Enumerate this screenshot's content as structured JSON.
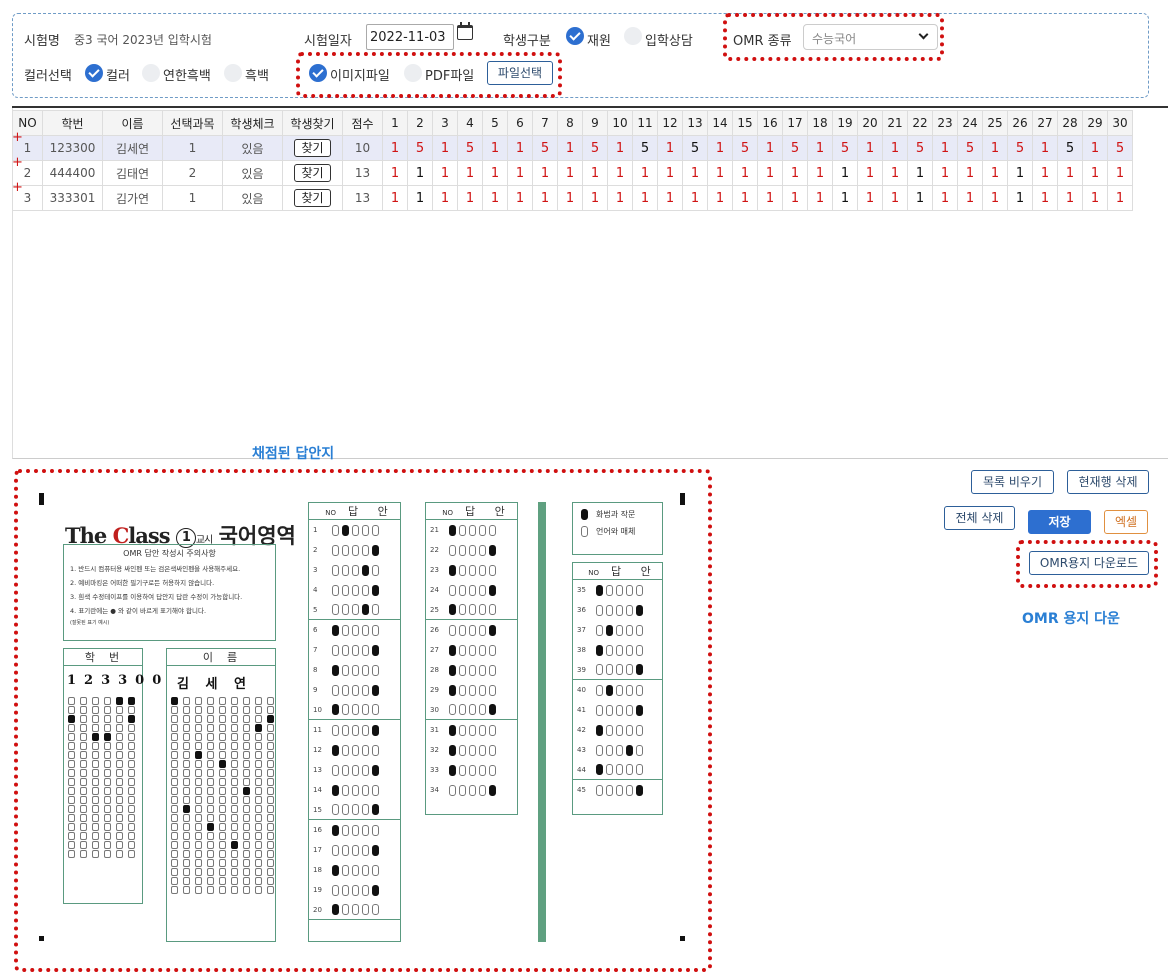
{
  "filters": {
    "exam_name_label": "시험명",
    "exam_name_value": "중3 국어 2023년 입학시험",
    "exam_date_label": "시험일자",
    "exam_date_value": "2022-11-03",
    "student_type_label": "학생구분",
    "student_type_options": [
      "재원",
      "입학상담"
    ],
    "omr_type_label": "OMR 종류",
    "omr_type_value": "수능국어",
    "color_label": "컬러선택",
    "color_options": [
      "컬러",
      "연한흑백",
      "흑백"
    ],
    "file_options": [
      "이미지파일",
      "PDF파일"
    ],
    "file_select_button": "파일선택"
  },
  "grid": {
    "headers": [
      "NO",
      "학번",
      "이름",
      "선택과목",
      "학생체크",
      "학생찾기",
      "점수"
    ],
    "question_numbers": [
      "1",
      "2",
      "3",
      "4",
      "5",
      "6",
      "7",
      "8",
      "9",
      "10",
      "11",
      "12",
      "13",
      "14",
      "15",
      "16",
      "17",
      "18",
      "19",
      "20",
      "21",
      "22",
      "23",
      "24",
      "25",
      "26",
      "27",
      "28",
      "29",
      "30"
    ],
    "find_label": "찾기",
    "rows": [
      {
        "no": "1",
        "id": "123300",
        "name": "김세연",
        "subject": "1",
        "check": "있음",
        "score": "10",
        "answers": [
          "1",
          "5",
          "1",
          "5",
          "1",
          "1",
          "5",
          "1",
          "5",
          "1",
          "5",
          "1",
          "5",
          "1",
          "5",
          "1",
          "5",
          "1",
          "5",
          "1",
          "1",
          "5",
          "1",
          "5",
          "1",
          "5",
          "1",
          "5",
          "1",
          "5"
        ],
        "correct": [
          11,
          13,
          28
        ]
      },
      {
        "no": "2",
        "id": "444400",
        "name": "김태연",
        "subject": "2",
        "check": "있음",
        "score": "13",
        "answers": [
          "1",
          "1",
          "1",
          "1",
          "1",
          "1",
          "1",
          "1",
          "1",
          "1",
          "1",
          "1",
          "1",
          "1",
          "1",
          "1",
          "1",
          "1",
          "1",
          "1",
          "1",
          "1",
          "1",
          "1",
          "1",
          "1",
          "1",
          "1",
          "1",
          "1"
        ],
        "correct": [
          2,
          19,
          22,
          26
        ]
      },
      {
        "no": "3",
        "id": "333301",
        "name": "김가연",
        "subject": "1",
        "check": "있음",
        "score": "13",
        "answers": [
          "1",
          "1",
          "1",
          "1",
          "1",
          "1",
          "1",
          "1",
          "1",
          "1",
          "1",
          "1",
          "1",
          "1",
          "1",
          "1",
          "1",
          "1",
          "1",
          "1",
          "1",
          "1",
          "1",
          "1",
          "1",
          "1",
          "1",
          "1",
          "1",
          "1"
        ],
        "correct": [
          2,
          19,
          22,
          26
        ]
      }
    ]
  },
  "section_title": "채점된 답안지",
  "actions": {
    "clear_list": "목록 비우기",
    "delete_current_row": "현재행 삭제",
    "delete_all": "전체 삭제",
    "save": "저장",
    "excel": "엑셀",
    "omr_download": "OMR용지 다운로드",
    "omr_download_caption": "OMR 용지 다운"
  },
  "omr_sheet": {
    "title_prefix": "The ",
    "title_c": "C",
    "title_rest": "lass ",
    "title_num": "1",
    "title_period": "교시",
    "title_subject": "국어영역",
    "notes_head": "OMR 답안 작성시 주의사항",
    "notes": [
      "1. 반드시 컴퓨터용 싸인펜 또는 검은색싸인펜을 사용해주세요.",
      "2. 예비마킹은 어떠한 필기구로든 허용하지 않습니다.",
      "3. 흰색 수정테이프를 이용하여 답안지 답란 수정이 가능합니다.",
      "4. 표기란에는 ● 와 같이 바르게 표기해야 합니다."
    ],
    "notes_example": "(잘못된 표기 예시)",
    "student_id_head": "학번",
    "name_head": "이름",
    "student_id_handwritten": "123300",
    "name_handwritten": "김 세 연",
    "answer_head_no": "NO",
    "answer_head": "답 안",
    "elective_options": [
      "화법과 작문",
      "언어와 매체"
    ],
    "col1": [
      {
        "n": "1",
        "f": 2
      },
      {
        "n": "2",
        "f": 5
      },
      {
        "n": "3",
        "f": 4
      },
      {
        "n": "4",
        "f": 5
      },
      {
        "n": "5",
        "f": 4
      },
      {
        "n": "6",
        "f": 1
      },
      {
        "n": "7",
        "f": 5
      },
      {
        "n": "8",
        "f": 1
      },
      {
        "n": "9",
        "f": 5
      },
      {
        "n": "10",
        "f": 1
      },
      {
        "n": "11",
        "f": 5
      },
      {
        "n": "12",
        "f": 1
      },
      {
        "n": "13",
        "f": 5
      },
      {
        "n": "14",
        "f": 1
      },
      {
        "n": "15",
        "f": 5
      },
      {
        "n": "16",
        "f": 1
      },
      {
        "n": "17",
        "f": 5
      },
      {
        "n": "18",
        "f": 1
      },
      {
        "n": "19",
        "f": 5
      },
      {
        "n": "20",
        "f": 1
      }
    ],
    "col2": [
      {
        "n": "21",
        "f": 1
      },
      {
        "n": "22",
        "f": 5
      },
      {
        "n": "23",
        "f": 1
      },
      {
        "n": "24",
        "f": 5
      },
      {
        "n": "25",
        "f": 1
      },
      {
        "n": "26",
        "f": 5
      },
      {
        "n": "27",
        "f": 1
      },
      {
        "n": "28",
        "f": 1
      },
      {
        "n": "29",
        "f": 1
      },
      {
        "n": "30",
        "f": 5
      },
      {
        "n": "31",
        "f": 1
      },
      {
        "n": "32",
        "f": 1
      },
      {
        "n": "33",
        "f": 1
      },
      {
        "n": "34",
        "f": 5
      }
    ],
    "col3": [
      {
        "n": "35",
        "f": 1
      },
      {
        "n": "36",
        "f": 5
      },
      {
        "n": "37",
        "f": 2
      },
      {
        "n": "38",
        "f": 1
      },
      {
        "n": "39",
        "f": 5
      },
      {
        "n": "40",
        "f": 2
      },
      {
        "n": "41",
        "f": 5
      },
      {
        "n": "42",
        "f": 1
      },
      {
        "n": "43",
        "f": 4
      },
      {
        "n": "44",
        "f": 1
      },
      {
        "n": "45",
        "f": 5
      }
    ]
  },
  "colors": {
    "accent": "#2d6fd0",
    "wrong": "#d01414",
    "highlight": "#d01010",
    "caption": "#2a7fd4",
    "omr_green": "#5fa080"
  }
}
